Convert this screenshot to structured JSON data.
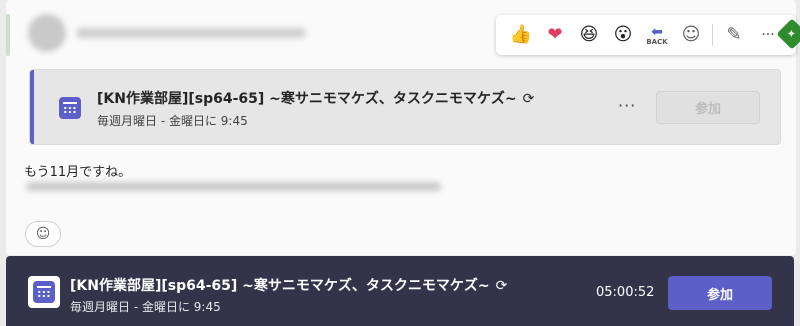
{
  "reactions": [
    {
      "icon": "thumbs-up-icon",
      "glyph": "👍"
    },
    {
      "icon": "heart-icon",
      "glyph": "❤"
    },
    {
      "icon": "laugh-icon",
      "glyph": "😆"
    },
    {
      "icon": "surprised-icon",
      "glyph": "😮"
    },
    {
      "icon": "back-icon",
      "glyph": "⬅",
      "caption": "BACK"
    },
    {
      "icon": "add-reaction-icon",
      "glyph": "☺"
    },
    {
      "icon": "edit-icon",
      "glyph": "✎"
    },
    {
      "icon": "more-options-icon",
      "glyph": "···"
    }
  ],
  "meeting_card": {
    "title": "[KN作業部屋][sp64-65] ~寒サニモマケズ、タスクニモマケズ~",
    "recurrence": "毎週月曜日 - 金曜日に 9:45",
    "more_glyph": "···",
    "join_label": "参加"
  },
  "message": {
    "text": "もう11月ですね。"
  },
  "bottom_bar": {
    "title": "[KN作業部屋][sp64-65] ~寒サニモマケズ、タスクニモマケズ~",
    "recurrence": "毎週月曜日 - 金曜日に 9:45",
    "elapsed": "05:00:52",
    "join_label": "参加"
  },
  "colors": {
    "accent": "#5b5fc7",
    "bottom_bar_bg": "#33344a",
    "pin_green": "#2e8b2e"
  }
}
